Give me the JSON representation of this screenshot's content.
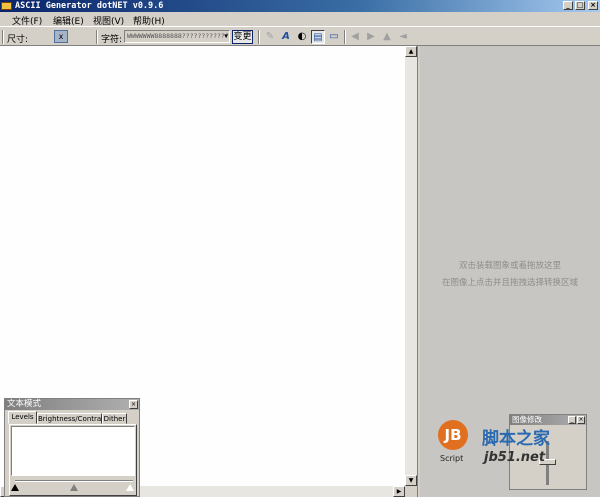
{
  "window": {
    "title": "ASCII Generator dotNET v0.9.6",
    "controls": {
      "minimize": "_",
      "maximize": "□",
      "close": "×"
    }
  },
  "menu": {
    "items": [
      {
        "label": "文件(F)"
      },
      {
        "label": "编辑(E)"
      },
      {
        "label": "视图(V)"
      },
      {
        "label": "帮助(H)"
      }
    ]
  },
  "toolbar": {
    "size_label": "尺寸:",
    "size_x": "x",
    "chars_label": "字符:",
    "chars_value": "WWWWWWW8888888????????????",
    "change_label": "变更",
    "icons": [
      {
        "name": "edit-icon",
        "glyph": "✎",
        "state": "disabled"
      },
      {
        "name": "font-icon",
        "glyph": "A",
        "state": "normal"
      },
      {
        "name": "contrast-icon",
        "glyph": "◐",
        "state": "normal"
      },
      {
        "name": "text-mode-icon",
        "glyph": "▤",
        "state": "pressed"
      },
      {
        "name": "preview-icon",
        "glyph": "▭",
        "state": "normal"
      },
      {
        "name": "rotate-left-icon",
        "glyph": "◀",
        "state": "disabled"
      },
      {
        "name": "rotate-right-icon",
        "glyph": "▶",
        "state": "disabled"
      },
      {
        "name": "flip-vertical-icon",
        "glyph": "▲",
        "state": "disabled"
      },
      {
        "name": "flip-horizontal-icon",
        "glyph": "◄",
        "state": "disabled"
      }
    ]
  },
  "image_pane": {
    "hint_line1": "双击装载图象或着拖放这里",
    "hint_line2": "在图像上点击并且拖拽选择转换区域"
  },
  "text_mode_panel": {
    "title": "文本模式",
    "tabs": [
      {
        "label": "Levels",
        "active": true
      },
      {
        "label": "Brightness/Contrast",
        "active": false
      },
      {
        "label": "Dither",
        "active": false
      }
    ],
    "levels": {
      "black_point": 0,
      "mid_point": 0.5,
      "white_point": 1
    }
  },
  "mini_panel": {
    "title": "图像修改",
    "slider_position": 0.5
  },
  "watermark": {
    "logo": "JB",
    "script": "Script",
    "name": "脚本之家",
    "domain": "jb51.net"
  },
  "colors": {
    "titlebar_start": "#0a246a",
    "window_bg": "#d4d0c8",
    "right_pane_bg": "#c8c6c2"
  }
}
